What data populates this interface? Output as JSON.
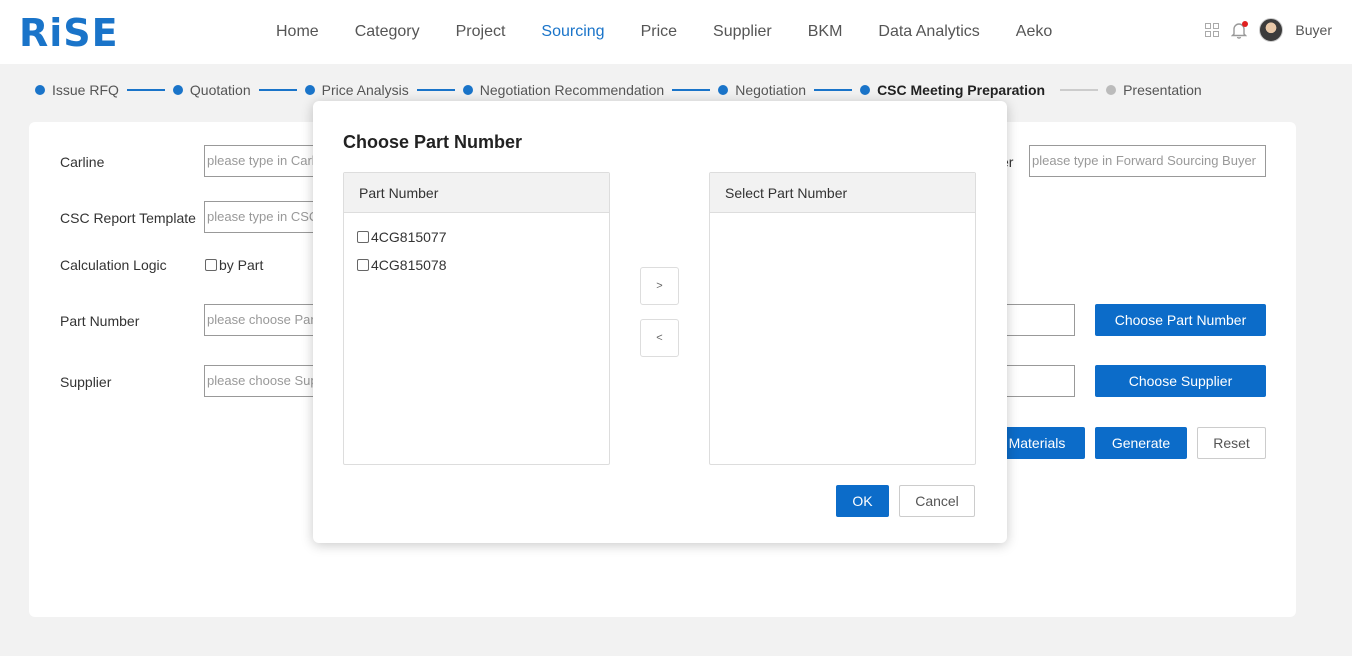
{
  "brand": {
    "logo": "RiSE",
    "accent": "#1a74c9"
  },
  "nav": {
    "items": [
      "Home",
      "Category",
      "Project",
      "Sourcing",
      "Price",
      "Supplier",
      "BKM",
      "Data Analytics",
      "Aeko"
    ],
    "active": "Sourcing"
  },
  "header": {
    "user_name": "Buyer",
    "icons": [
      "apps-grid-icon",
      "notification-bell-icon",
      "user-avatar"
    ]
  },
  "steps": [
    {
      "label": "Issue RFQ",
      "state": "done"
    },
    {
      "label": "Quotation",
      "state": "done"
    },
    {
      "label": "Price Analysis",
      "state": "done"
    },
    {
      "label": "Negotiation Recommendation",
      "state": "done"
    },
    {
      "label": "Negotiation",
      "state": "done"
    },
    {
      "label": "CSC Meeting Preparation",
      "state": "current"
    },
    {
      "label": "Presentation",
      "state": "pending"
    }
  ],
  "form": {
    "carline_label": "Carline",
    "carline_placeholder": "please type in Carline",
    "template_label": "CSC Report Template",
    "template_placeholder": "please type in CSC Report Template",
    "calc_label": "Calculation Logic",
    "calc_option": "by Part",
    "part_label": "Part Number",
    "part_placeholder": "please choose Part Number",
    "supplier_label": "Supplier",
    "supplier_placeholder": "please choose Supplier",
    "fsb_label_tail": "er",
    "fsb_placeholder": "please type in Forward Sourcing Buyer",
    "choose_part_btn": "Choose Part Number",
    "choose_supplier_btn": "Choose Supplier",
    "materials_btn": "Materials",
    "generate_btn": "Generate",
    "reset_btn": "Reset"
  },
  "modal": {
    "title": "Choose Part Number",
    "left_header": "Part Number",
    "right_header": "Select Part Number",
    "parts": [
      "4CG815077",
      "4CG815078"
    ],
    "selected": [],
    "move_right": ">",
    "move_left": "<",
    "ok": "OK",
    "cancel": "Cancel"
  }
}
